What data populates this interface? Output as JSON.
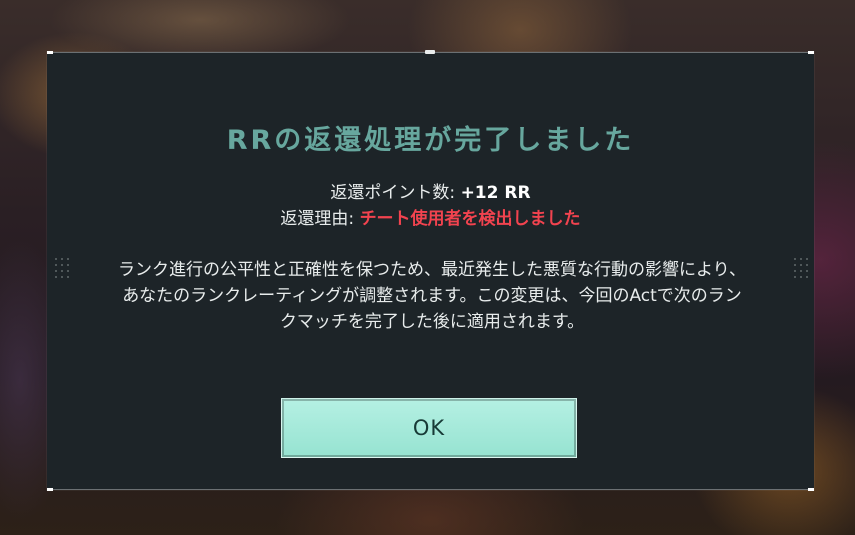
{
  "dialog": {
    "title": "RRの返還処理が完了しました",
    "points_label": "返還ポイント数: ",
    "points_value": "+12 RR",
    "reason_label": "返還理由: ",
    "reason_value": "チート使用者を検出しました",
    "body": "ランク進行の公平性と正確性を保つため、最近発生した悪質な行動の影響により、あなたのランクレーティングが調整されます。この変更は、今回のActで次のランクマッチを完了した後に適用されます。",
    "ok_label": "OK"
  },
  "colors": {
    "title": "#67a79e",
    "reason": "#f2434f",
    "button": "#a8ebdc",
    "panel": "#1d2428"
  }
}
